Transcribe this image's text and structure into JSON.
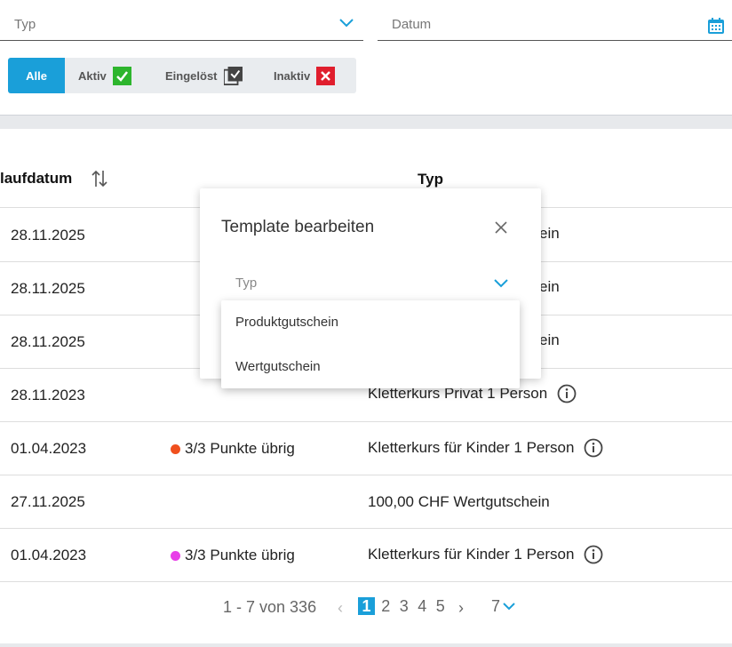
{
  "filters": {
    "typ_placeholder": "Typ",
    "datum_placeholder": "Datum",
    "segments": [
      {
        "label": "Alle",
        "active": true
      },
      {
        "label": "Aktiv",
        "icon": "check-green-icon"
      },
      {
        "label": "Eingelöst",
        "icon": "redeemed-copy-icon"
      },
      {
        "label": "Inaktiv",
        "icon": "x-red-icon"
      }
    ]
  },
  "table": {
    "headers": {
      "ablaufdatum": "laufdatum",
      "typ": "Typ"
    },
    "rows": [
      {
        "date": "28.11.2025",
        "points": "",
        "typ": "ein"
      },
      {
        "date": "28.11.2025",
        "points": "",
        "typ": "ein"
      },
      {
        "date": "28.11.2025",
        "points": "",
        "typ": "ein"
      },
      {
        "date": "28.11.2023",
        "points": "",
        "typ": "Kletterkurs Privat 1 Person"
      },
      {
        "date": "01.04.2023",
        "points": "3/3 Punkte übrig",
        "dot_color": "#f0501e",
        "typ": "Kletterkurs für Kinder 1 Person"
      },
      {
        "date": "27.11.2025",
        "points": "",
        "typ": "100,00 CHF Wertgutschein"
      },
      {
        "date": "01.04.2023",
        "points": "3/3 Punkte übrig",
        "dot_color": "#e83ee8",
        "typ": "Kletterkurs für Kinder 1 Person"
      }
    ]
  },
  "pagination": {
    "range": "1 - 7 von 336",
    "pages": [
      "1",
      "2",
      "3",
      "4",
      "5"
    ],
    "current": "1",
    "page_size": "7"
  },
  "modal": {
    "title": "Template bearbeiten",
    "typ_placeholder": "Typ",
    "options": [
      "Produktgutschein",
      "Wertgutschein"
    ]
  },
  "colors": {
    "accent": "#1a9fd9"
  }
}
